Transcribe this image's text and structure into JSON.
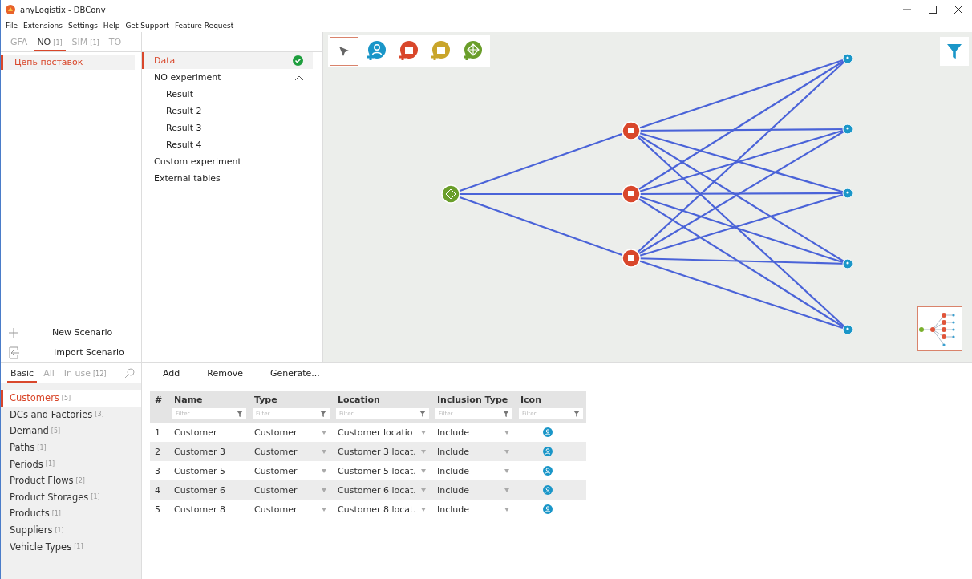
{
  "window": {
    "title": "anyLogistix - DBConv"
  },
  "menu": [
    "File",
    "Extensions",
    "Settings",
    "Help",
    "Get Support",
    "Feature Request"
  ],
  "scenario_tabs": [
    {
      "label": "GFA",
      "selected": false
    },
    {
      "label": "NO",
      "count": "[1]",
      "selected": true
    },
    {
      "label": "SIM",
      "count": "[1]",
      "selected": false
    },
    {
      "label": "TO",
      "selected": false
    }
  ],
  "scenarios": [
    {
      "label": "Цепь поставок",
      "selected": true
    }
  ],
  "scenario_actions": [
    {
      "kind": "new",
      "label": "New Scenario"
    },
    {
      "kind": "import",
      "label": "Import Scenario"
    }
  ],
  "experiments": [
    {
      "label": "Data",
      "selected": true,
      "done": true
    },
    {
      "label": "NO experiment",
      "selected": false,
      "expanded": true,
      "children": [
        {
          "label": "Result"
        },
        {
          "label": "Result 2"
        },
        {
          "label": "Result 3"
        },
        {
          "label": "Result 4"
        }
      ]
    },
    {
      "label": "Custom experiment",
      "selected": false
    },
    {
      "label": "External tables",
      "selected": false
    }
  ],
  "map_tools": [
    {
      "kind": "pointer",
      "selected": true
    },
    {
      "kind": "customer",
      "selected": false
    },
    {
      "kind": "dc",
      "selected": false
    },
    {
      "kind": "factory",
      "selected": false
    },
    {
      "kind": "supplier",
      "selected": false
    }
  ],
  "table_actions": [
    "Add",
    "Remove",
    "Generate..."
  ],
  "category_tabs": [
    {
      "label": "Basic",
      "selected": true
    },
    {
      "label": "All",
      "selected": false
    },
    {
      "label": "In use",
      "count": "[12]",
      "selected": false
    }
  ],
  "categories": [
    {
      "label": "Customers",
      "count": "[5]",
      "selected": true
    },
    {
      "label": "DCs and Factories",
      "count": "[3]",
      "selected": false
    },
    {
      "label": "Demand",
      "count": "[5]",
      "selected": false
    },
    {
      "label": "Paths",
      "count": "[1]",
      "selected": false
    },
    {
      "label": "Periods",
      "count": "[1]",
      "selected": false
    },
    {
      "label": "Product Flows",
      "count": "[2]",
      "selected": false
    },
    {
      "label": "Product Storages",
      "count": "[1]",
      "selected": false
    },
    {
      "label": "Products",
      "count": "[1]",
      "selected": false
    },
    {
      "label": "Suppliers",
      "count": "[1]",
      "selected": false
    },
    {
      "label": "Vehicle Types",
      "count": "[1]",
      "selected": false
    }
  ],
  "table": {
    "columns": [
      {
        "label": "#"
      },
      {
        "label": "Name",
        "filter": "Filter"
      },
      {
        "label": "Type",
        "filter": "Filter"
      },
      {
        "label": "Location",
        "filter": "Filter"
      },
      {
        "label": "Inclusion Type",
        "filter": "Filter"
      },
      {
        "label": "Icon",
        "filter": "Filter"
      }
    ],
    "rows": [
      {
        "index": "1",
        "name": "Customer",
        "type": "Customer",
        "location": "Customer locatio",
        "inclusion": "Include"
      },
      {
        "index": "2",
        "name": "Customer 3",
        "type": "Customer",
        "location": "Customer 3 locat.",
        "inclusion": "Include"
      },
      {
        "index": "3",
        "name": "Customer 5",
        "type": "Customer",
        "location": "Customer 5 locat.",
        "inclusion": "Include"
      },
      {
        "index": "4",
        "name": "Customer 6",
        "type": "Customer",
        "location": "Customer 6 locat.",
        "inclusion": "Include"
      },
      {
        "index": "5",
        "name": "Customer 8",
        "type": "Customer",
        "location": "Customer 8 locat.",
        "inclusion": "Include"
      }
    ]
  }
}
